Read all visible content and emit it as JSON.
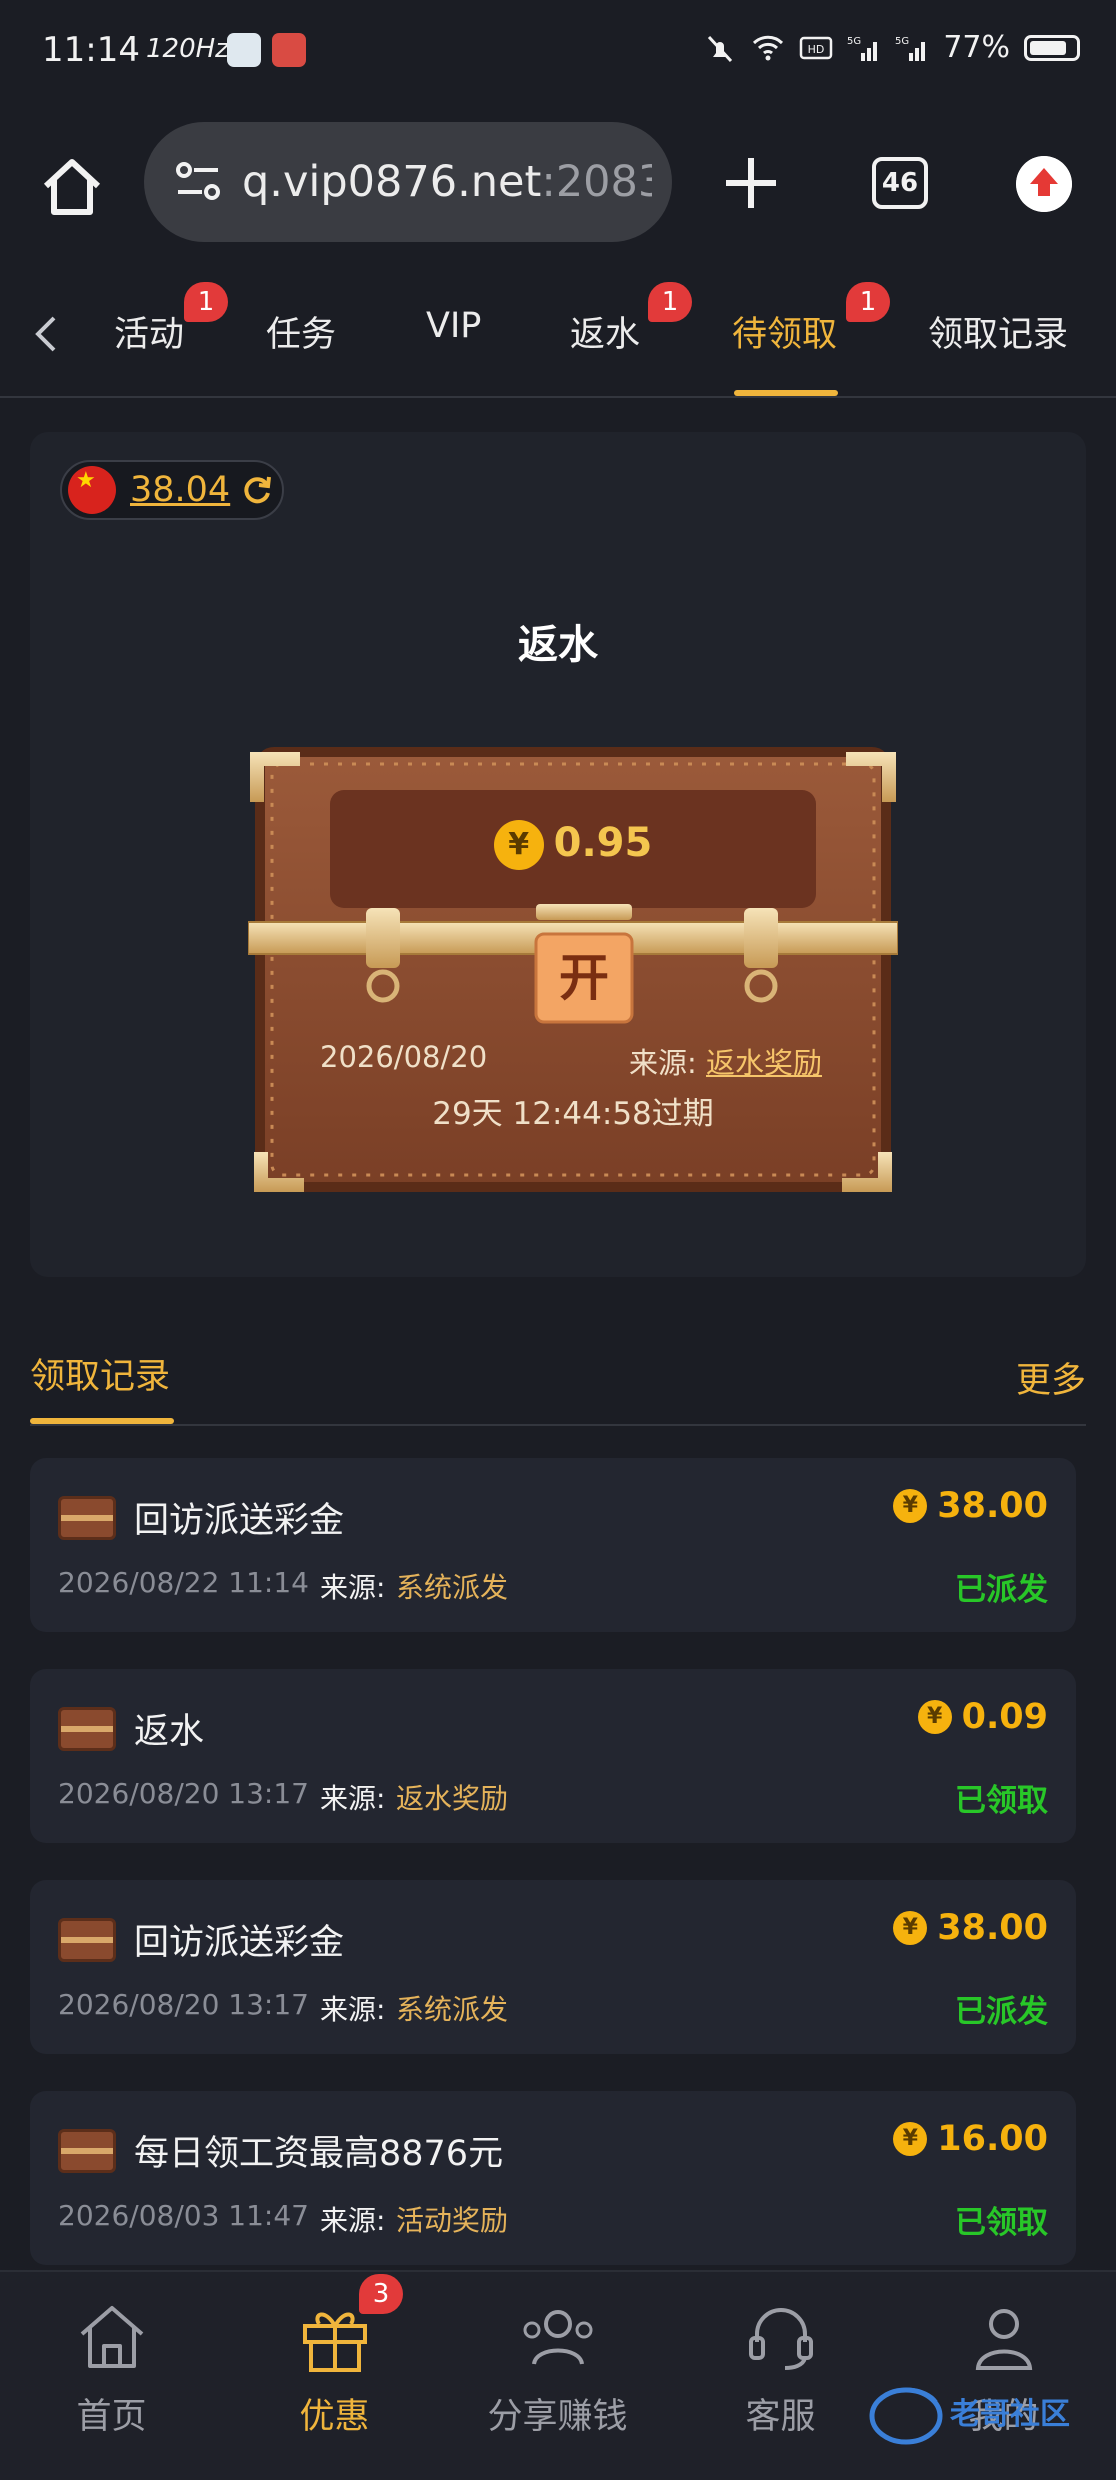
{
  "status_bar": {
    "time": "11:14",
    "refresh_rate": "120Hz",
    "battery": "77%"
  },
  "browser": {
    "url_main": "q.vip0876.net",
    "url_port": ":2083",
    "tab_count": "46"
  },
  "nav_tabs": [
    {
      "label": "活动",
      "badge": "1"
    },
    {
      "label": "任务"
    },
    {
      "label": "VIP"
    },
    {
      "label": "返水",
      "badge": "1"
    },
    {
      "label": "待领取",
      "badge": "1",
      "active": true
    },
    {
      "label": "领取记录"
    }
  ],
  "wallet": {
    "balance": "38.04"
  },
  "claim_card": {
    "title": "返水",
    "currency_symbol": "¥",
    "amount": "0.95",
    "open_label": "开",
    "date": "2026/08/20",
    "source_label": "来源:",
    "source": "返水奖励",
    "expire": "29天 12:44:58过期"
  },
  "records_section": {
    "title": "领取记录",
    "more": "更多"
  },
  "records": [
    {
      "name": "回访派送彩金",
      "amount": "38.00",
      "datetime": "2026/08/22 11:14",
      "source_label": "来源:",
      "source": "系统派发",
      "status": "已派发"
    },
    {
      "name": "返水",
      "amount": "0.09",
      "datetime": "2026/08/20 13:17",
      "source_label": "来源:",
      "source": "返水奖励",
      "status": "已领取"
    },
    {
      "name": "回访派送彩金",
      "amount": "38.00",
      "datetime": "2026/08/20 13:17",
      "source_label": "来源:",
      "source": "系统派发",
      "status": "已派发"
    },
    {
      "name": "每日领工资最高8876元",
      "amount": "16.00",
      "datetime": "2026/08/03 11:47",
      "source_label": "来源:",
      "source": "活动奖励",
      "status": "已领取"
    }
  ],
  "bottom_nav": [
    {
      "label": "首页",
      "icon": "home-icon"
    },
    {
      "label": "优惠",
      "icon": "gift-icon",
      "badge": "3",
      "active": true
    },
    {
      "label": "分享赚钱",
      "icon": "share-people-icon"
    },
    {
      "label": "客服",
      "icon": "headset-icon"
    },
    {
      "label": "我的",
      "icon": "user-icon"
    }
  ],
  "colors": {
    "accent": "#f0b53c",
    "badge": "#e23a3a",
    "status_green": "#28c728",
    "background": "#1b1d24"
  }
}
